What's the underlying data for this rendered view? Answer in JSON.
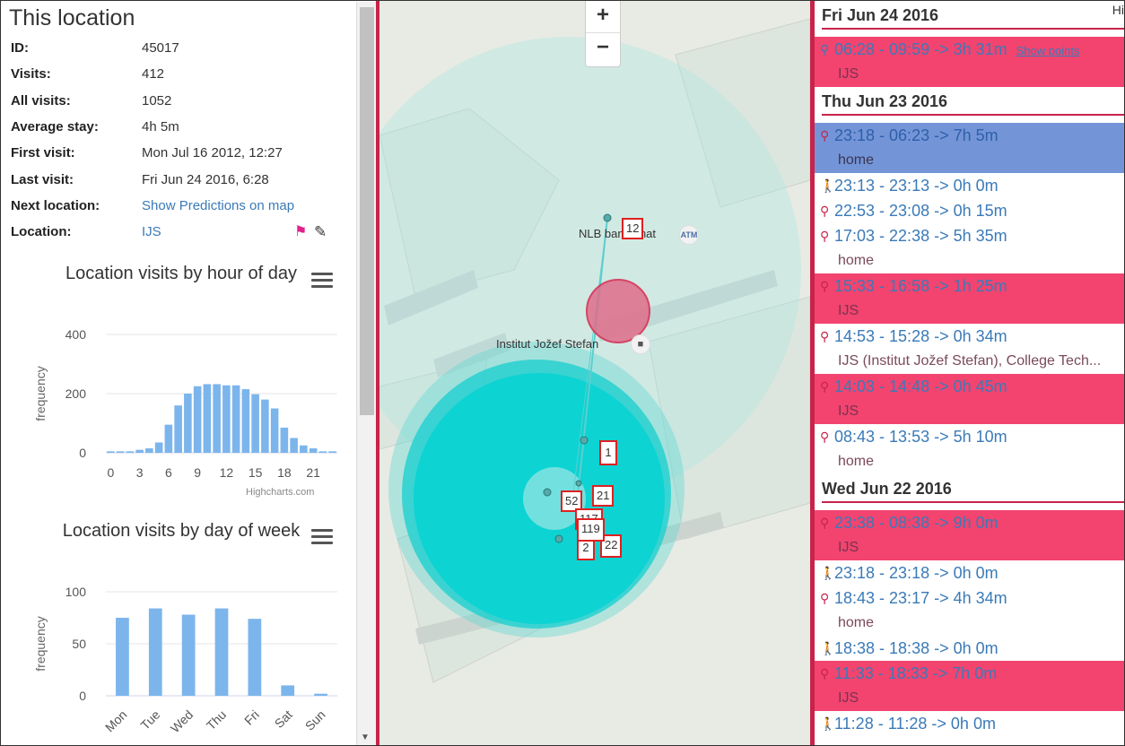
{
  "title": "This location",
  "info": [
    {
      "label": "ID:",
      "value": "45017"
    },
    {
      "label": "Visits:",
      "value": "412"
    },
    {
      "label": "All visits:",
      "value": "1052"
    },
    {
      "label": "Average stay:",
      "value": "4h 5m"
    },
    {
      "label": "First visit:",
      "value": "Mon Jul 16 2012, 12:27"
    },
    {
      "label": "Last visit:",
      "value": "Fri Jun 24 2016, 6:28"
    },
    {
      "label": "Next location:",
      "value": "Show Predictions on map"
    },
    {
      "label": "Location:",
      "value": "IJS"
    }
  ],
  "colors": {
    "accent": "#c8234a",
    "bar": "#7cb5ec",
    "pink_row": "#f2446f",
    "blue_row": "#7395d8",
    "link": "#3a7ab8"
  },
  "chart_data": [
    {
      "type": "bar",
      "title": "Location visits by hour of day",
      "ylabel": "frequency",
      "categories": [
        0,
        1,
        2,
        3,
        4,
        5,
        6,
        7,
        8,
        9,
        10,
        11,
        12,
        13,
        14,
        15,
        16,
        17,
        18,
        19,
        20,
        21,
        22,
        23
      ],
      "xticks": [
        "0",
        "3",
        "6",
        "9",
        "12",
        "15",
        "18",
        "21"
      ],
      "yticks": [
        "0",
        "200",
        "400"
      ],
      "values": [
        5,
        5,
        5,
        10,
        15,
        35,
        95,
        160,
        200,
        225,
        232,
        232,
        228,
        228,
        215,
        198,
        180,
        150,
        85,
        50,
        25,
        15,
        5,
        5
      ],
      "ylim": [
        0,
        400
      ],
      "credit": "Highcharts.com"
    },
    {
      "type": "bar",
      "title": "Location visits by day of week",
      "ylabel": "frequency",
      "categories": [
        "Mon",
        "Tue",
        "Wed",
        "Thu",
        "Fri",
        "Sat",
        "Sun"
      ],
      "yticks": [
        "0",
        "50",
        "100"
      ],
      "values": [
        75,
        84,
        78,
        84,
        74,
        10,
        2
      ],
      "ylim": [
        0,
        100
      ]
    }
  ],
  "map": {
    "zoom_in": "+",
    "zoom_out": "−",
    "labels": {
      "atm": "NLB bankomat",
      "atm_icon": "ATM",
      "institute": "Institut Jožef Stefan"
    },
    "markers": [
      "12",
      "1",
      "52",
      "21",
      "117",
      "119",
      "22",
      "2"
    ]
  },
  "timeline": {
    "corner": "Hi",
    "days": [
      {
        "date": "Fri Jun 24 2016",
        "visits": [
          {
            "icon": "location-pin-icon",
            "text": "06:28 - 09:59 -> 3h 31m",
            "link": "Show points",
            "style": "pink",
            "sub": "IJS"
          }
        ]
      },
      {
        "date": "Thu Jun 23 2016",
        "visits": [
          {
            "icon": "location-pin-icon",
            "text": "23:18 - 06:23 -> 7h 5m",
            "style": "blue",
            "sub": "home"
          },
          {
            "icon": "walking-icon",
            "text": "23:13 - 23:13 -> 0h 0m",
            "style": "plain"
          },
          {
            "icon": "location-pin-icon",
            "text": "22:53 - 23:08 -> 0h 15m",
            "style": "plain"
          },
          {
            "icon": "location-pin-icon",
            "text": "17:03 - 22:38 -> 5h 35m",
            "style": "plain",
            "sub": "home"
          },
          {
            "icon": "location-pin-icon",
            "text": "15:33 - 16:58 -> 1h 25m",
            "style": "pink",
            "sub": "IJS"
          },
          {
            "icon": "location-pin-icon",
            "text": "14:53 - 15:28 -> 0h 34m",
            "style": "plain",
            "sub": "IJS (Institut Jožef Stefan), College Tech..."
          },
          {
            "icon": "location-pin-icon",
            "text": "14:03 - 14:48 -> 0h 45m",
            "style": "pink",
            "sub": "IJS"
          },
          {
            "icon": "location-pin-icon",
            "text": "08:43 - 13:53 -> 5h 10m",
            "style": "plain",
            "sub": "home"
          }
        ]
      },
      {
        "date": "Wed Jun 22 2016",
        "visits": [
          {
            "icon": "location-pin-icon",
            "text": "23:38 - 08:38 -> 9h 0m",
            "style": "pink",
            "sub": "IJS"
          },
          {
            "icon": "walking-icon",
            "text": "23:18 - 23:18 -> 0h 0m",
            "style": "plain"
          },
          {
            "icon": "location-pin-icon",
            "text": "18:43 - 23:17 -> 4h 34m",
            "style": "plain",
            "sub": "home"
          },
          {
            "icon": "walking-icon",
            "text": "18:38 - 18:38 -> 0h 0m",
            "style": "plain"
          },
          {
            "icon": "location-pin-icon",
            "text": "11:33 - 18:33 -> 7h 0m",
            "style": "pink",
            "sub": "IJS"
          },
          {
            "icon": "walking-icon",
            "text": "11:28 - 11:28 -> 0h 0m",
            "style": "plain"
          }
        ]
      }
    ]
  }
}
